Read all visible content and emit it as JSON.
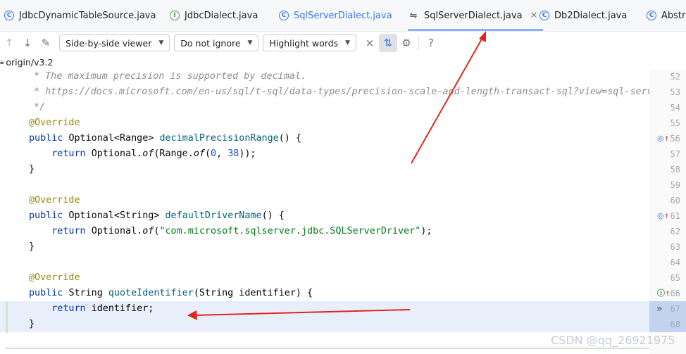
{
  "tabs": [
    {
      "label": "JdbcDynamicTableSource.java",
      "icon": "class-icon",
      "active": false
    },
    {
      "label": "JdbcDialect.java",
      "icon": "interface-icon",
      "active": false
    },
    {
      "label": "SqlServerDialect.java",
      "icon": "class-icon",
      "active": false
    },
    {
      "label": "SqlServerDialect.java",
      "icon": "diff-icon",
      "active": true
    },
    {
      "label": "Db2Dialect.java",
      "icon": "class-icon",
      "active": false
    },
    {
      "label": "Abstra",
      "icon": "class-icon",
      "active": false
    }
  ],
  "toolbar": {
    "viewer_label": "Side-by-side viewer",
    "ignore_label": "Do not ignore",
    "highlight_label": "Highlight words",
    "help_label": "?"
  },
  "branch": {
    "label": "origin/v3.2"
  },
  "code": {
    "line52": "* The maximum precision is supported by decimal.",
    "line53": "* https://docs.microsoft.com/en-us/sql/t-sql/data-types/precision-scale-and-length-transact-sql?view=sql-serv",
    "line54": "*/",
    "override": "@Override",
    "kw_public": "public",
    "kw_return": "return",
    "optional_range": "Optional<Range>",
    "m_decimal": "decimalPrecisionRange",
    "sig_tail": "() {",
    "optional": "Optional.",
    "of": "of",
    "range_open": "(Range.",
    "paren_open": "(",
    "n0": "0",
    "comma": ", ",
    "n38": "38",
    "close57": "));",
    "brace": "}",
    "optional_string": "Optional<String>",
    "m_driver": "defaultDriverName",
    "driver_str": "\"com.microsoft.sqlserver.jdbc.SQLServerDriver\"",
    "close62": ");",
    "string_t": "String",
    "m_quote": "quoteIdentifier",
    "params66": "(String identifier) {",
    "ret67": "identifier;"
  },
  "line_numbers": [
    "52",
    "53",
    "54",
    "55",
    "56",
    "57",
    "58",
    "59",
    "60",
    "61",
    "62",
    "63",
    "64",
    "65",
    "66",
    "67",
    "68"
  ],
  "watermark": "CSDN @qq_26921975"
}
